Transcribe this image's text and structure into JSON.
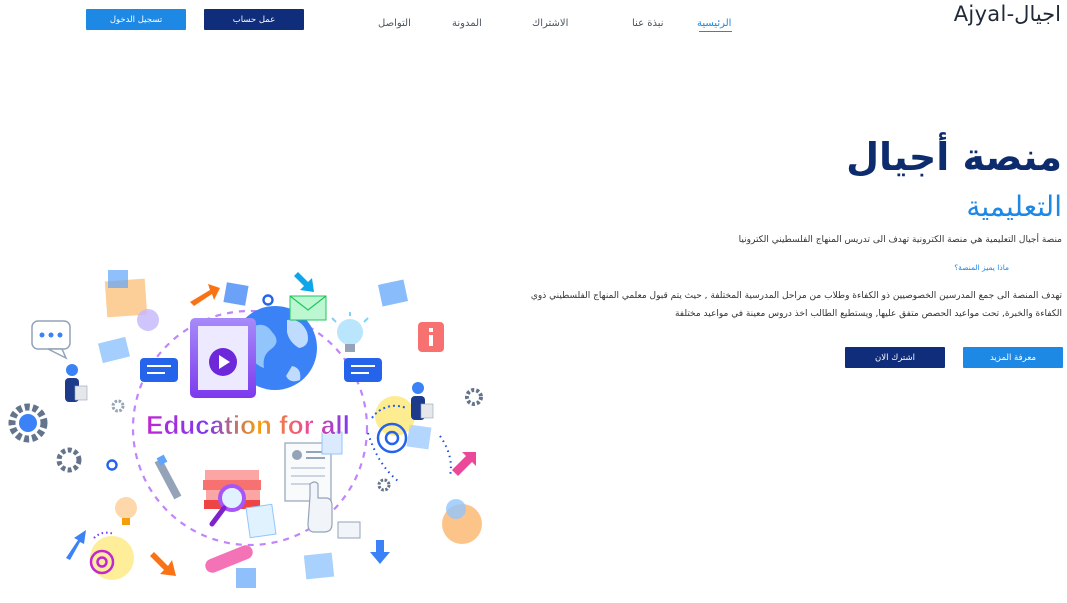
{
  "header": {
    "brand": "اجيال-Ajyal",
    "nav": [
      {
        "label": "الرئيسية",
        "active": true
      },
      {
        "label": "نبذة عنا",
        "active": false
      },
      {
        "label": "الاشتراك",
        "active": false
      },
      {
        "label": "المدونة",
        "active": false
      },
      {
        "label": "التواصل",
        "active": false
      }
    ],
    "signup_label": "عمل حساب",
    "login_label": "تسجيل الدخول"
  },
  "hero": {
    "title": "منصة أجيال",
    "subtitle": "التعليمية",
    "description": "منصة أجيال التعليمية هي منصة الكترونية تهدف الى تدريس المنهاج الفلسطيني الكترونيا",
    "features_link": "ماذا يميز المنصة؟",
    "paragraph": "تهدف المنصة الى جمع المدرسين الخصوصيين ذو الكفاءة وطلاب من مراحل المدرسية المختلفة , حيث يتم قبول معلمي المنهاج الفلسطيني ذوي الكفاءة والخبرة, تحت مواعيد الحصص متفق عليها, ويستطيع الطالب اخذ دروس معينة في مواعيد مختلفة",
    "learn_more_label": "معرفة المزيد",
    "subscribe_label": "اشترك الان"
  },
  "illustration": {
    "banner_text": "Education for all"
  },
  "colors": {
    "brand_dark": "#0f2d7a",
    "brand_blue": "#1e88e5",
    "title_navy": "#0d2c6e"
  }
}
